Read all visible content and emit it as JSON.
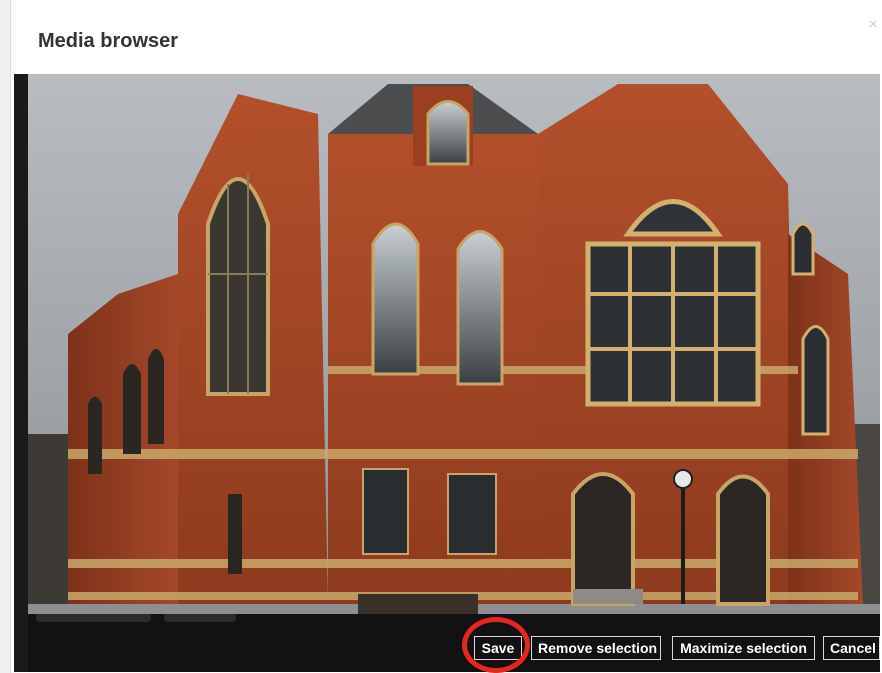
{
  "dialog": {
    "title": "Media browser",
    "close_glyph": "×"
  },
  "media": {
    "photo_description_icon": "photo-brick-building"
  },
  "actions": {
    "save_label": "Save",
    "remove_label": "Remove selection",
    "maximize_label": "Maximize selection",
    "cancel_label": "Cancel"
  },
  "colors": {
    "highlight_ring": "#e6261f",
    "button_bg": "#111111",
    "button_text": "#ffffff"
  }
}
